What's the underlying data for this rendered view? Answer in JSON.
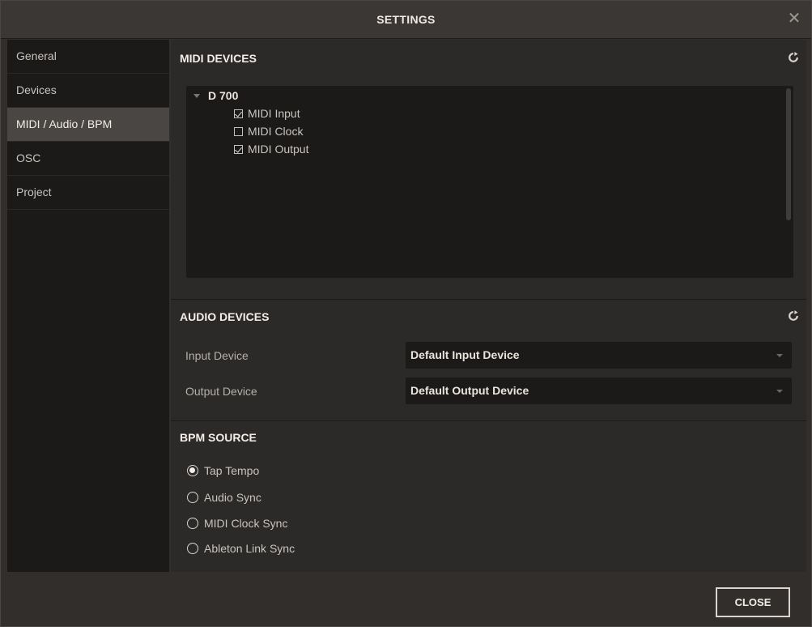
{
  "window": {
    "title": "SETTINGS"
  },
  "sidebar": {
    "items": [
      {
        "label": "General"
      },
      {
        "label": "Devices"
      },
      {
        "label": "MIDI / Audio / BPM"
      },
      {
        "label": "OSC"
      },
      {
        "label": "Project"
      }
    ],
    "active_index": 2
  },
  "midi": {
    "title": "MIDI DEVICES",
    "device": "D 700",
    "options": [
      {
        "label": "MIDI Input",
        "checked": true
      },
      {
        "label": "MIDI Clock",
        "checked": false
      },
      {
        "label": "MIDI Output",
        "checked": true
      }
    ]
  },
  "audio": {
    "title": "AUDIO DEVICES",
    "input_label": "Input Device",
    "input_value": "Default Input Device",
    "output_label": "Output Device",
    "output_value": "Default Output Device"
  },
  "bpm": {
    "title": "BPM SOURCE",
    "options": [
      {
        "label": "Tap Tempo",
        "selected": true
      },
      {
        "label": "Audio Sync",
        "selected": false
      },
      {
        "label": "MIDI Clock Sync",
        "selected": false
      },
      {
        "label": "Ableton Link Sync",
        "selected": false
      }
    ]
  },
  "footer": {
    "close_label": "CLOSE"
  },
  "icons": {
    "close": "close-icon",
    "refresh": "refresh-icon",
    "caret": "caret-down-icon"
  }
}
